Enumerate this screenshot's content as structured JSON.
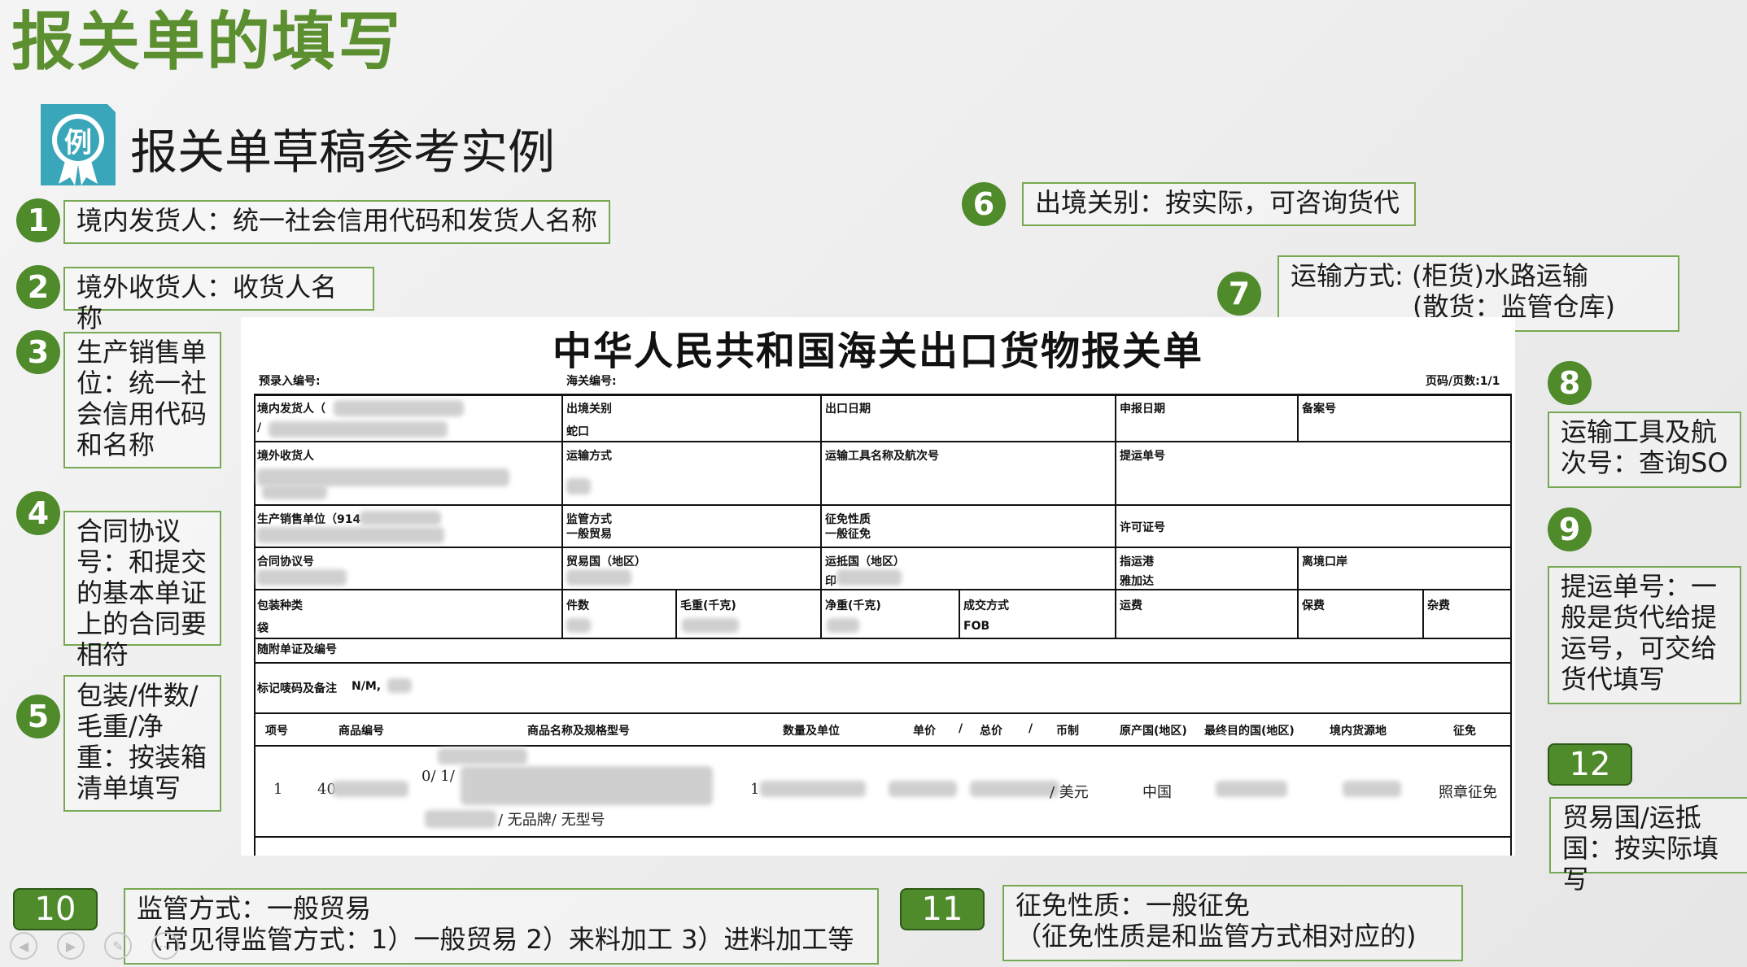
{
  "slide": {
    "title": "报关单的填写",
    "subtitle": "报关单草稿参考实例",
    "example_badge": "例"
  },
  "badges": [
    "1",
    "2",
    "3",
    "4",
    "5",
    "6",
    "7",
    "8",
    "9",
    "10",
    "11",
    "12"
  ],
  "notes": {
    "n1": "境内发货人：统一社会信用代码和发货人名称",
    "n2": "境外收货人：收货人名称",
    "n3": "生产销售单位：统一社会信用代码和名称",
    "n4": "合同协议号：和提交的基本单证上的合同要相符",
    "n5": "包装/件数/毛重/净重：按装箱清单填写",
    "n6": "出境关别：按实际，可咨询货代",
    "n7_line1": "运输方式: (柜货)水路运输",
    "n7_line2": "(散货：监管仓库)",
    "n8": "运输工具及航次号：查询SO",
    "n9": "提运单号：一般是货代给提运号，可交给货代填写",
    "n10_line1": "监管方式：一般贸易",
    "n10_line2": "（常见得监管方式：1）一般贸易 2）来料加工 3）进料加工等",
    "n11_line1": "征免性质：一般征免",
    "n11_line2": "（征免性质是和监管方式相对应的)",
    "n12": "贸易国/运抵国：按实际填写"
  },
  "form": {
    "title": "中华人民共和国海关出口货物报关单",
    "pre_entry_no": "预录入编号:",
    "customs_no": "海关编号:",
    "page": "页码/页数:1/1",
    "labels": {
      "shipper": "境内发货人（",
      "exit_customs": "出境关别",
      "export_date": "出口日期",
      "declare_date": "申报日期",
      "record_no": "备案号",
      "consignee": "境外收货人",
      "transport_mode": "运输方式",
      "vessel": "运输工具名称及航次号",
      "bl_no": "提运单号",
      "producer": "生产销售单位（914",
      "supervision": "监管方式",
      "exemption": "征免性质",
      "license": "许可证号",
      "contract": "合同协议号",
      "trade_country": "贸易国（地区）",
      "dest_country": "运抵国（地区）",
      "dest_port": "指运港",
      "exit_port": "离境口岸",
      "pack_type": "包装种类",
      "pieces": "件数",
      "gross": "毛重(千克)",
      "net": "净重(千克)",
      "deal": "成交方式",
      "freight": "运费",
      "insurance": "保费",
      "misc": "杂费",
      "attached": "随附单证及编号",
      "marks": "标记唛码及备注",
      "marks_val": "N/M,"
    },
    "values": {
      "shipper_slash": "/",
      "exit_customs": "蛇口",
      "supervision": "一般贸易",
      "exemption": "一般征免",
      "dest_country_prefix": "印",
      "dest_port": "雅加达",
      "pack_type": "袋",
      "deal": "FOB"
    },
    "goods_headers": [
      "项号",
      "商品编号",
      "商品名称及规格型号",
      "数量及单位",
      "单价",
      "/",
      "总价",
      "/",
      "币制",
      "原产国(地区)",
      "最终目的国(地区)",
      "境内货源地",
      "征免"
    ],
    "goods_row": {
      "no": "1",
      "code_prefix": "40",
      "name_prefix": "0/ 1/",
      "brand": "/ 无品牌/ 无型号",
      "qty_prefix": "1",
      "currency": "/ 美元",
      "origin": "中国",
      "duty": "照章征免"
    }
  }
}
